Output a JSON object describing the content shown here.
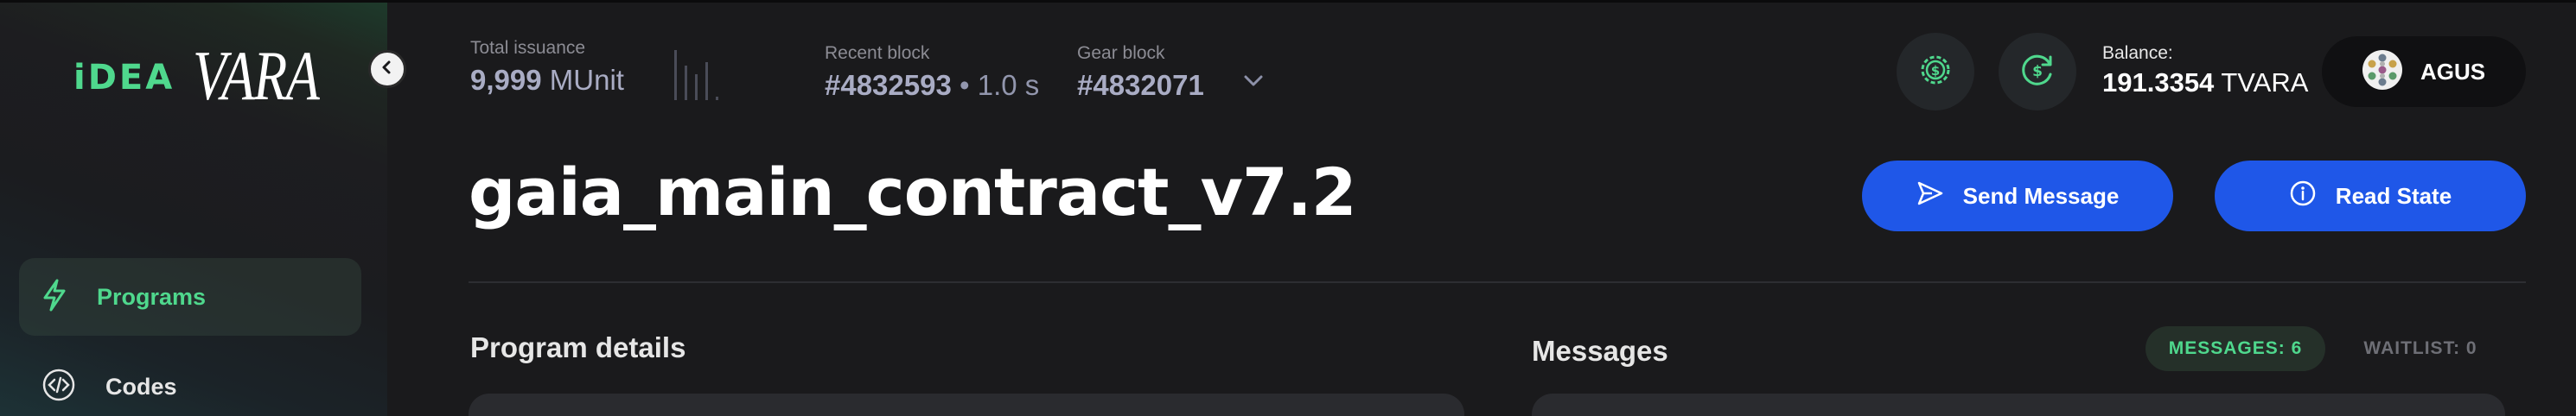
{
  "brand": {
    "idea": "iDEA",
    "vara": "VARA"
  },
  "sidebar": {
    "items": [
      {
        "label": "Programs",
        "icon": "lightning-icon",
        "active": true
      },
      {
        "label": "Codes",
        "icon": "code-icon",
        "active": false
      }
    ]
  },
  "header": {
    "total_issuance": {
      "label": "Total issuance",
      "value": "9,999",
      "unit": "MUnit"
    },
    "recent_block": {
      "label": "Recent block",
      "value": "#4832593",
      "separator": "•",
      "time": "1.0 s"
    },
    "gear_block": {
      "label": "Gear block",
      "value": "#4832071"
    },
    "balance": {
      "label": "Balance:",
      "value": "191.3354",
      "unit": "TVARA"
    },
    "account": {
      "name": "AGUS"
    }
  },
  "main": {
    "title": "gaia_main_contract_v7.2",
    "actions": {
      "send_message": "Send Message",
      "read_state": "Read State"
    },
    "program_details_title": "Program details",
    "messages_title": "Messages",
    "tabs": {
      "messages": "MESSAGES: 6",
      "waitlist": "WAITLIST: 0"
    }
  },
  "colors": {
    "accent_green": "#4fd88d",
    "primary_blue": "#1f57e8",
    "background": "#1a1a1c"
  }
}
